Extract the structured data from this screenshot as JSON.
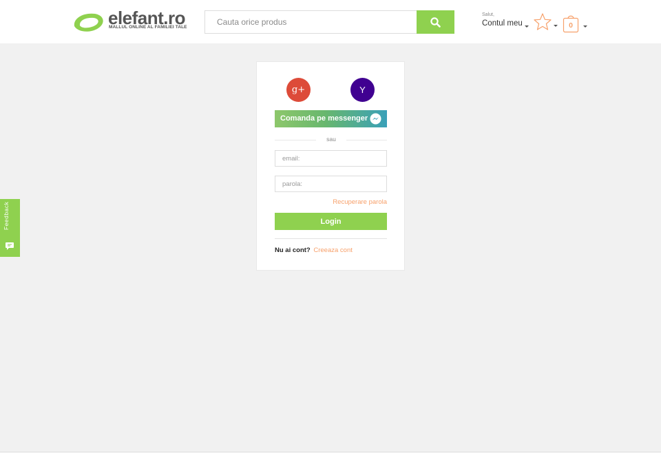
{
  "header": {
    "logo": {
      "name": "elefant.ro",
      "tagline": "MALLUL ONLINE AL FAMILIEI TALE",
      "icon": "elefant-leaf-logo"
    },
    "search": {
      "placeholder": "Cauta orice produs",
      "button_icon": "search-icon"
    },
    "account": {
      "greeting": "Salut,",
      "label": "Contul meu"
    },
    "wishlist": {
      "icon": "star-icon"
    },
    "cart": {
      "icon": "shopping-bag-icon",
      "count": "0"
    }
  },
  "login": {
    "social": {
      "google_label": "g+",
      "yahoo_label": "Y"
    },
    "messenger_label": "Comanda pe messenger",
    "separator": "sau",
    "email_placeholder": "email:",
    "password_placeholder": "parola:",
    "recover_link": "Recuperare parola",
    "login_button": "Login",
    "no_account": "Nu ai cont?",
    "create_account": "Creeaza cont"
  },
  "feedback": {
    "label": "Feedback"
  },
  "colors": {
    "brand_green": "#8fd14f",
    "accent_orange": "#f7a06a",
    "google_red": "#dd4b39",
    "yahoo_purple": "#400191"
  }
}
